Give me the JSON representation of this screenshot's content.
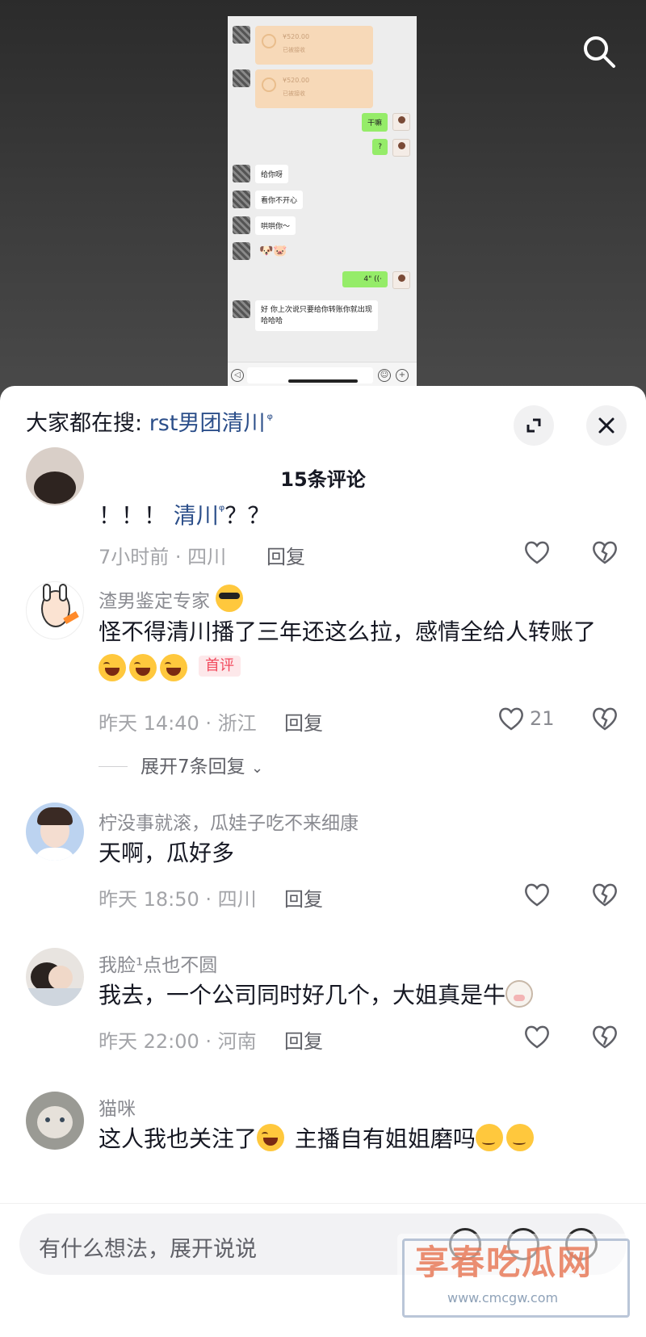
{
  "screenshot": {
    "transfers": [
      {
        "amount": "¥520.00",
        "note": "已被接收"
      },
      {
        "amount": "¥520.00",
        "note": "已被接收"
      }
    ],
    "messages": {
      "m1": "干嘛",
      "m2": "?",
      "m3": "给你呀",
      "m4": "看你不开心",
      "m5": "哄哄你～",
      "m6": "🐶🐷",
      "m7": "4\" ((·",
      "m8a": "好 你上次说只要给你转账你就出现",
      "m8b": "哈哈哈"
    }
  },
  "sheet": {
    "hot_search_prefix": "大家都在搜: ",
    "hot_search_keyword": "rst男团清川",
    "hot_search_icon": "search-small-icon",
    "count_title": "15条评论"
  },
  "comments": [
    {
      "text_a": "！！！  ",
      "text_link": "清川",
      "text_link_icon": "ᵠ",
      "text_b": "？？",
      "meta": "7小时前 · 四川",
      "reply": "回复",
      "likes": ""
    },
    {
      "name": "渣男鉴定专家",
      "text_a": "怪不得清川播了三年还这么拉，感情全给人转账了",
      "badge": "首评",
      "meta": "昨天 14:40 · 浙江",
      "reply": "回复",
      "likes": "21",
      "expand": "展开7条回复"
    },
    {
      "name": "柠没事就滚，瓜娃子吃不来细康",
      "text_a": "天啊，瓜好多",
      "meta": "昨天 18:50 · 四川",
      "reply": "回复",
      "likes": ""
    },
    {
      "name": "我脸¹点也不圆",
      "text_a": "我去，一个公司同时好几个，大姐真是牛",
      "meta": "昨天 22:00 · 河南",
      "reply": "回复",
      "likes": ""
    },
    {
      "name": "猫咪",
      "text_a": "这人我也关注了",
      "text_b": " 主播自有姐姐磨吗"
    }
  ],
  "input": {
    "placeholder": "有什么想法，展开说说"
  },
  "watermark": {
    "title": "享春吃瓜网",
    "url": "www.cmcgw.com"
  },
  "colors": {
    "link": "#2c4f8a",
    "badge": "#f24b5e",
    "chat_green": "#95ec69"
  }
}
